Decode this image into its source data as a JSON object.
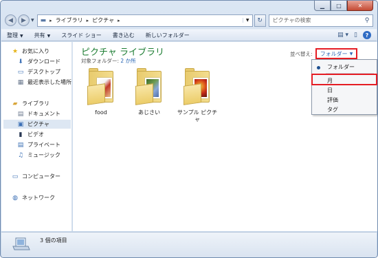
{
  "address": {
    "crumbs": [
      "ライブラリ",
      "ピクチャ"
    ],
    "search_placeholder": "ピクチャの検索"
  },
  "toolbar": {
    "items": [
      "整理",
      "共有",
      "スライド ショー",
      "書き込む",
      "新しいフォルダー"
    ]
  },
  "nav": {
    "favorites": "お気に入り",
    "downloads": "ダウンロード",
    "desktop": "デスクトップ",
    "recent": "最近表示した場所",
    "libraries": "ライブラリ",
    "documents": "ドキュメント",
    "pictures": "ピクチャ",
    "videos": "ビデオ",
    "private": "プライベート",
    "music": "ミュージック",
    "computer": "コンピューター",
    "network": "ネットワーク"
  },
  "content": {
    "title": "ピクチャ ライブラリ",
    "subtitle_prefix": "対象フォルダー: ",
    "subtitle_link": "2 か所",
    "arrange_label": "並べ替え:",
    "arrange_value": "フォルダー",
    "folders": [
      {
        "label": "food"
      },
      {
        "label": "あじさい"
      },
      {
        "label": "サンプル ピクチャ"
      }
    ]
  },
  "arrange_menu": {
    "items": [
      "フォルダー",
      "月",
      "日",
      "評価",
      "タグ"
    ],
    "selected": "フォルダー",
    "highlighted": "月"
  },
  "status": {
    "count_text": "3 個の項目"
  },
  "colors": {
    "library_title": "#1c7d32",
    "link": "#2060b0",
    "highlight_box": "#e51c23"
  }
}
